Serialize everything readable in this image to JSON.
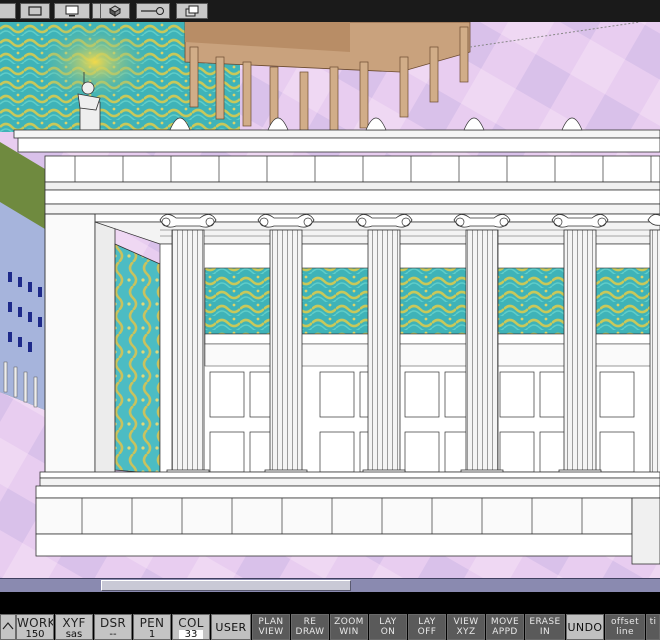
{
  "toolbar": {
    "icons": [
      "view-window-icon",
      "monitor-icon",
      "zoom-window-icon",
      "cube-3d-icon",
      "line-circle-icon",
      "layers-icon"
    ]
  },
  "params": [
    {
      "label": "WORK",
      "value": "150"
    },
    {
      "label": "XYF",
      "value": "sas"
    },
    {
      "label": "DSR",
      "value": "--"
    },
    {
      "label": "PEN",
      "value": "1"
    },
    {
      "label": "COL",
      "value": "33"
    }
  ],
  "user_label": "USER",
  "commands": [
    {
      "line1": "PLAN",
      "line2": "VIEW"
    },
    {
      "line1": "RE",
      "line2": "DRAW"
    },
    {
      "line1": "ZOOM",
      "line2": "WIN"
    },
    {
      "line1": "LAY",
      "line2": "ON"
    },
    {
      "line1": "LAY",
      "line2": "OFF"
    },
    {
      "line1": "VIEW",
      "line2": "XYZ"
    },
    {
      "line1": "MOVE",
      "line2": "APPD"
    },
    {
      "line1": "ERASE",
      "line2": "IN"
    }
  ],
  "undo_label": "UNDO",
  "offset_command": {
    "line1": "offset",
    "line2": "line"
  },
  "truncated_command": {
    "line1": "ti",
    "line2": ""
  },
  "colors": {
    "sky_pink": "#e6c9ef",
    "teal_texture": "#3fb3b8",
    "yellow_texture": "#c8c85a",
    "wood": "#c9a27d",
    "building_blue": "#a6b4dc"
  }
}
